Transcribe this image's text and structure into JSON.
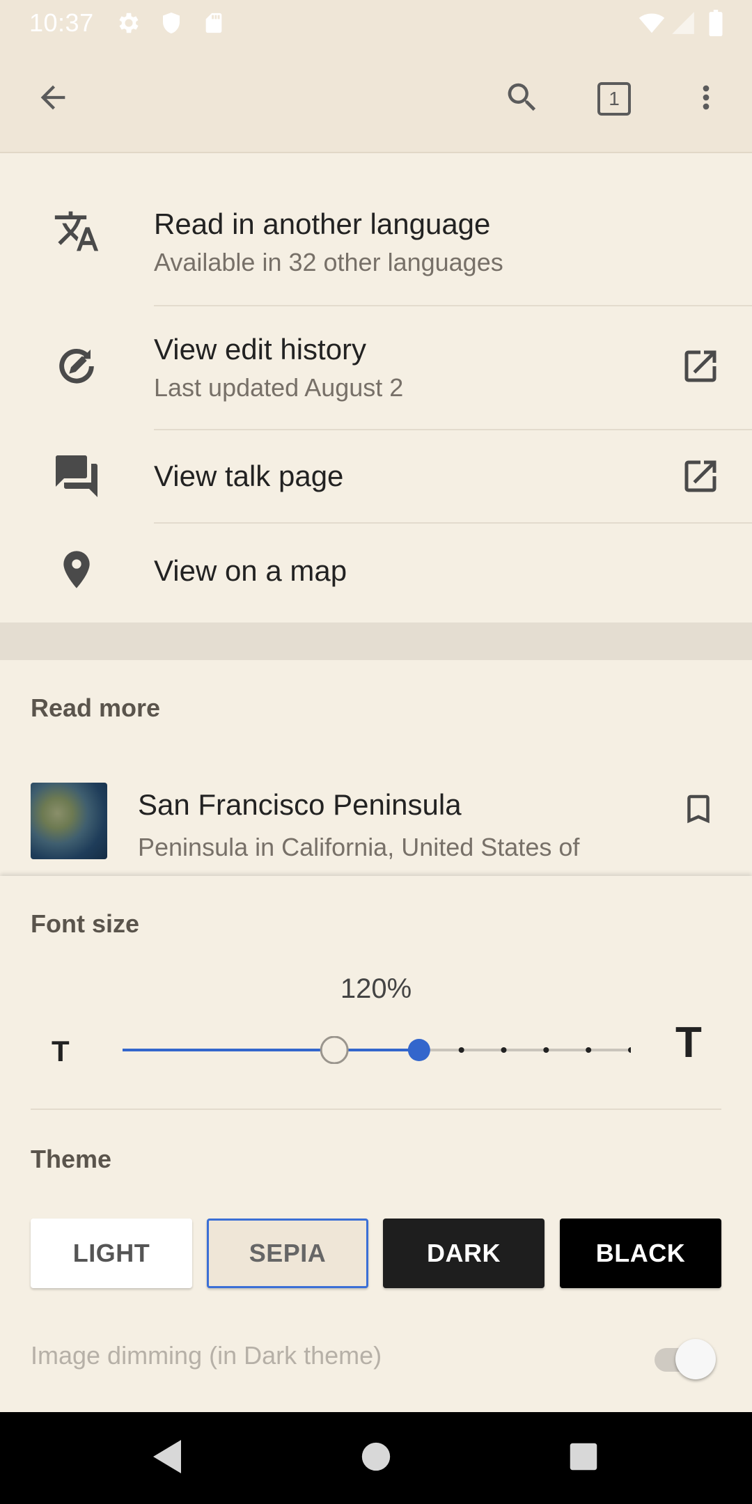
{
  "status_bar": {
    "time": "10:37",
    "icons": [
      "gear-icon",
      "shield-icon",
      "sd-card-icon",
      "wifi-icon",
      "signal-icon",
      "battery-icon"
    ]
  },
  "toolbar": {
    "back_icon": "arrow-back-icon",
    "search_icon": "search-icon",
    "tabs_count": "1",
    "more_icon": "more-vert-icon"
  },
  "menu": {
    "items": [
      {
        "title": "Read in another language",
        "subtitle": "Available in 32 other languages",
        "icon": "translate-icon"
      },
      {
        "title": "View edit history",
        "subtitle": "Last updated August 2",
        "icon": "edit-history-icon",
        "external": true
      },
      {
        "title": "View talk page",
        "icon": "talk-icon",
        "external": true
      },
      {
        "title": "View on a map",
        "icon": "map-pin-icon"
      }
    ]
  },
  "read_more": {
    "label": "Read more",
    "article": {
      "title": "San Francisco Peninsula",
      "description": "Peninsula in California, United States of"
    }
  },
  "font_size": {
    "label": "Font size",
    "value": "120%",
    "small_t": "T",
    "large_t": "T",
    "steps": 13,
    "default_step": 5,
    "current_step": 7
  },
  "theme": {
    "label": "Theme",
    "options": [
      "LIGHT",
      "SEPIA",
      "DARK",
      "BLACK"
    ],
    "selected": "SEPIA"
  },
  "image_dimming": {
    "label": "Image dimming (in Dark theme)",
    "enabled": false
  },
  "colors": {
    "accent": "#3366cc",
    "background": "#f5efe3",
    "toolbar": "#efe6d7"
  }
}
